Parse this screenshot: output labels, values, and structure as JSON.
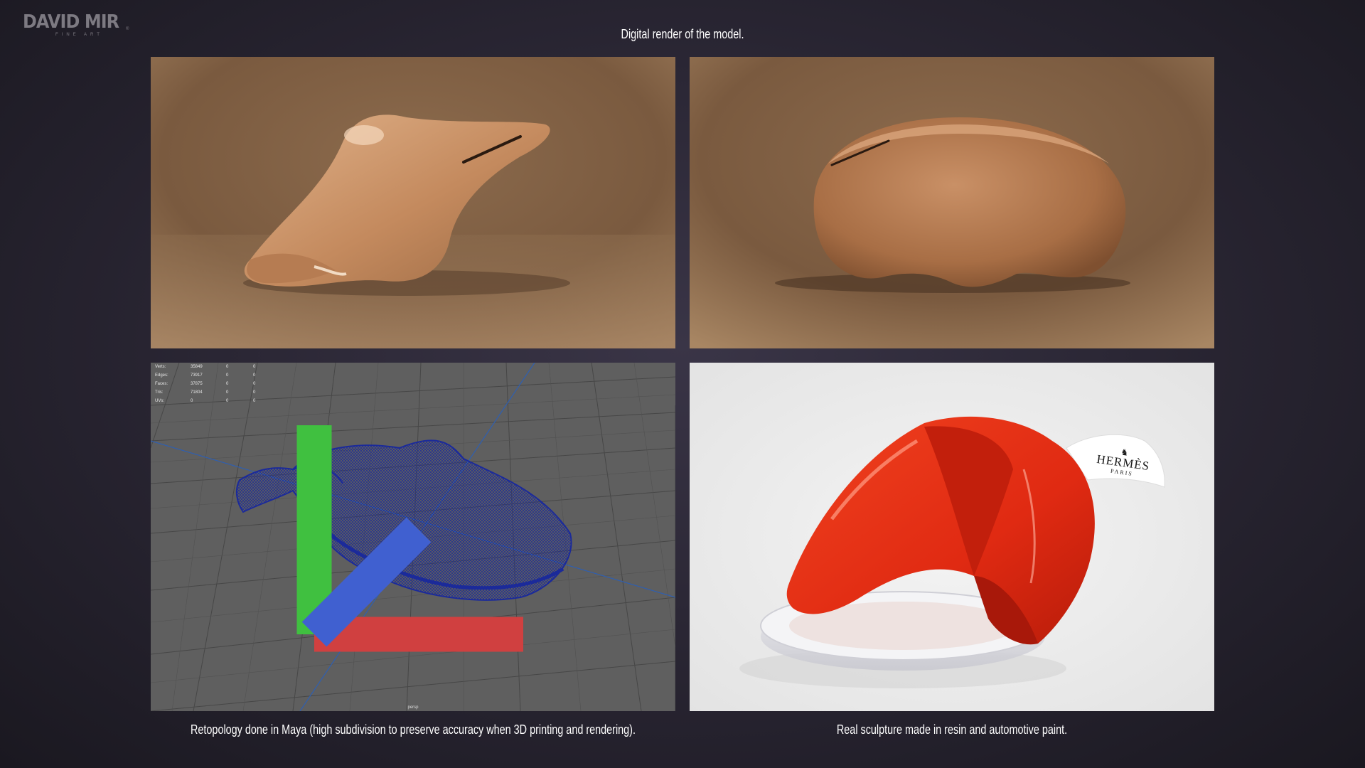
{
  "branding": {
    "logo_text": "DAVID MIR",
    "logo_sub": "FINE ART",
    "logo_mark": "®"
  },
  "captions": {
    "top": "Digital render of the model.",
    "bottom_left": "Retopology done in Maya (high subdivision to preserve accuracy when 3D printing and rendering).",
    "bottom_right": "Real sculpture made in resin and automotive paint."
  },
  "maya_stats": [
    {
      "label": "Verts:",
      "value": "35849",
      "c2": "0",
      "c3": "0"
    },
    {
      "label": "Edges:",
      "value": "73917",
      "c2": "0",
      "c3": "0"
    },
    {
      "label": "Faces:",
      "value": "37875",
      "c2": "0",
      "c3": "0"
    },
    {
      "label": "Tris:",
      "value": "71804",
      "c2": "0",
      "c3": "0"
    },
    {
      "label": "UVs:",
      "value": "0",
      "c2": "0",
      "c3": "0"
    }
  ],
  "viewport_label": "persp",
  "tag": {
    "brand": "HERMÈS",
    "city": "PARIS"
  },
  "colors": {
    "render_bg": "#8a6a4c",
    "sculpture_tan": "#c8926a",
    "maya_bg": "#5d5d5d",
    "wire_blue": "#1b2a9a",
    "resin_red": "#e8321a",
    "photo_bg": "#ececec"
  }
}
